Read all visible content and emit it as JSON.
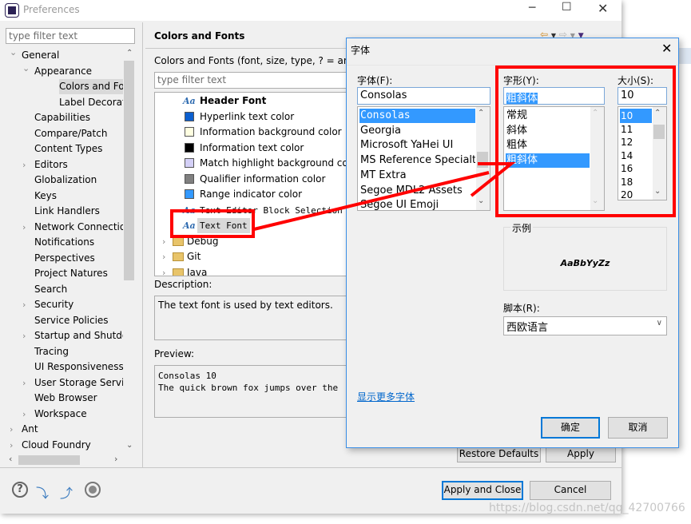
{
  "window": {
    "title": "Preferences"
  },
  "sidebar": {
    "filter_placeholder": "type filter text",
    "items": [
      {
        "label": "General",
        "level": 0,
        "expanded": true
      },
      {
        "label": "Appearance",
        "level": 1,
        "expanded": true
      },
      {
        "label": "Colors and Fonts",
        "level": 2,
        "selected": true
      },
      {
        "label": "Label Decorations",
        "level": 2
      },
      {
        "label": "Capabilities",
        "level": 1
      },
      {
        "label": "Compare/Patch",
        "level": 1
      },
      {
        "label": "Content Types",
        "level": 1
      },
      {
        "label": "Editors",
        "level": 1,
        "collapsed": true
      },
      {
        "label": "Globalization",
        "level": 1
      },
      {
        "label": "Keys",
        "level": 1
      },
      {
        "label": "Link Handlers",
        "level": 1
      },
      {
        "label": "Network Connections",
        "level": 1,
        "collapsed": true
      },
      {
        "label": "Notifications",
        "level": 1
      },
      {
        "label": "Perspectives",
        "level": 1
      },
      {
        "label": "Project Natures",
        "level": 1
      },
      {
        "label": "Search",
        "level": 1
      },
      {
        "label": "Security",
        "level": 1,
        "collapsed": true
      },
      {
        "label": "Service Policies",
        "level": 1
      },
      {
        "label": "Startup and Shutdown",
        "level": 1,
        "collapsed": true
      },
      {
        "label": "Tracing",
        "level": 1
      },
      {
        "label": "UI Responsiveness",
        "level": 1
      },
      {
        "label": "User Storage Service",
        "level": 1,
        "collapsed": true
      },
      {
        "label": "Web Browser",
        "level": 1
      },
      {
        "label": "Workspace",
        "level": 1,
        "collapsed": true
      },
      {
        "label": "Ant",
        "level": 0,
        "collapsed": true
      },
      {
        "label": "Cloud Foundry",
        "level": 0,
        "collapsed": true
      }
    ]
  },
  "main": {
    "title": "Colors and Fonts",
    "subtitle": "Colors and Fonts (font, size, type, ? = any c",
    "filter_placeholder": "type filter text",
    "tree": [
      {
        "label": "Header Font",
        "type": "font",
        "bold": true
      },
      {
        "label": "Hyperlink text color",
        "type": "color",
        "color": "#0b5fcf"
      },
      {
        "label": "Information background color",
        "type": "color",
        "color": "#ffffe1"
      },
      {
        "label": "Information text color",
        "type": "color",
        "color": "#000000"
      },
      {
        "label": "Match highlight background color",
        "type": "color",
        "color": "#d4d0f7"
      },
      {
        "label": "Qualifier information color",
        "type": "color",
        "color": "#808080"
      },
      {
        "label": "Range indicator color",
        "type": "color",
        "color": "#3399ff"
      },
      {
        "label": "Text Editor Block Selection Font",
        "type": "font",
        "mono": true
      },
      {
        "label": "Text Font",
        "type": "font",
        "mono": true,
        "selected": true
      },
      {
        "label": "Debug",
        "type": "folder"
      },
      {
        "label": "Git",
        "type": "folder"
      },
      {
        "label": "Java",
        "type": "folder"
      }
    ],
    "description_label": "Description:",
    "description": "The text font is used by text editors.",
    "preview_label": "Preview:",
    "preview_line1": "Consolas 10",
    "preview_line2": "The quick brown fox jumps over the",
    "restore_defaults": "Restore Defaults",
    "apply": "Apply"
  },
  "footer": {
    "apply_close": "Apply and Close",
    "cancel": "Cancel",
    "icons": [
      "help-icon",
      "import-icon",
      "export-icon",
      "record-icon"
    ]
  },
  "font_dialog": {
    "title": "字体",
    "font_label": "字体(F):",
    "font_value": "Consolas",
    "fonts": [
      "Consolas",
      "Georgia",
      "Microsoft YaHei UI",
      "MS Reference Specialty",
      "MT Extra",
      "Segoe MDL2 Assets",
      "Segoe UI Emoji"
    ],
    "style_label": "字形(Y):",
    "style_value": "粗斜体",
    "styles": [
      "常规",
      "斜体",
      "粗体",
      "粗斜体"
    ],
    "size_label": "大小(S):",
    "size_value": "10",
    "sizes": [
      "10",
      "11",
      "12",
      "14",
      "16",
      "18",
      "20"
    ],
    "sample_label": "示例",
    "sample_text": "AaBbYyZz",
    "script_label": "脚本(R):",
    "script_value": "西欧语言",
    "more_fonts_link": "显示更多字体",
    "ok": "确定",
    "cancel": "取消"
  },
  "watermark": "https://blog.csdn.net/qq_42700766",
  "colors": {
    "accent": "#0078d7",
    "selection": "#3399ff",
    "annotation": "#ff0000"
  }
}
